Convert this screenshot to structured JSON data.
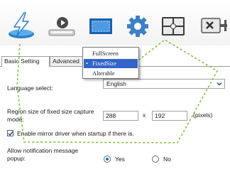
{
  "toolbar": {
    "icons": [
      "capture-icon",
      "record-icon",
      "screen-icon",
      "settings-icon",
      "layout-icon",
      "exit-icon"
    ]
  },
  "tabs": {
    "basic": "Basic Setting",
    "advanced": "Advanced"
  },
  "menu": {
    "items": [
      "FullScreen",
      "FixedSize",
      "Alterable"
    ],
    "selected": "FixedSize",
    "bullet": "•"
  },
  "form": {
    "language_label": "Language select:",
    "language_value": "English",
    "region_label": "Region size of fixed size capture mode:",
    "width_value": "288",
    "height_value": "192",
    "times": "x",
    "unit": "(pixels)",
    "mirror_label": "Enable mirror driver when startup if there is.",
    "mirror_checked": true,
    "notify_label": "Allow notification message popup:",
    "yes_label": "Yes",
    "no_label": "No",
    "notify_selected": "Yes"
  },
  "colors": {
    "menu_highlight": "#3464c8",
    "selection_marquee": "#7ac043",
    "radio_dot": "#1a6fd1"
  }
}
